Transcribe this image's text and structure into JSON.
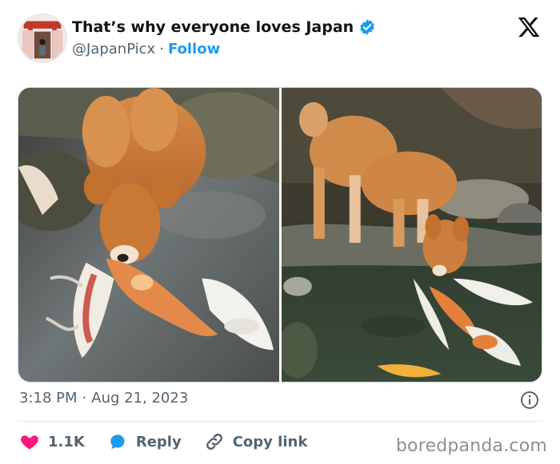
{
  "author": {
    "display_name": "That’s why everyone loves Japan",
    "handle": "@JapanPicx",
    "separator": "·",
    "follow_label": "Follow",
    "verified_color": "#1d9bf0"
  },
  "media": {
    "photos": [
      {
        "alt": "Shiba Inu dog leaning down to touch a koi fish in a pond"
      },
      {
        "alt": "Shiba Inu standing on rocks, nose to koi fish in a pond"
      }
    ]
  },
  "timestamp": {
    "time": "3:18 PM",
    "separator": "·",
    "date": "Aug 21, 2023"
  },
  "actions": {
    "likes": "1.1K",
    "reply": "Reply",
    "copy_link": "Copy link"
  },
  "watermark": "boredpanda.com",
  "colors": {
    "accent": "#1d9bf0",
    "heart": "#f91880",
    "text_secondary": "#536471"
  },
  "icons": [
    "avatar-image",
    "verified-badge-icon",
    "x-logo-icon",
    "info-icon",
    "heart-icon",
    "reply-bubble-icon",
    "link-icon"
  ]
}
